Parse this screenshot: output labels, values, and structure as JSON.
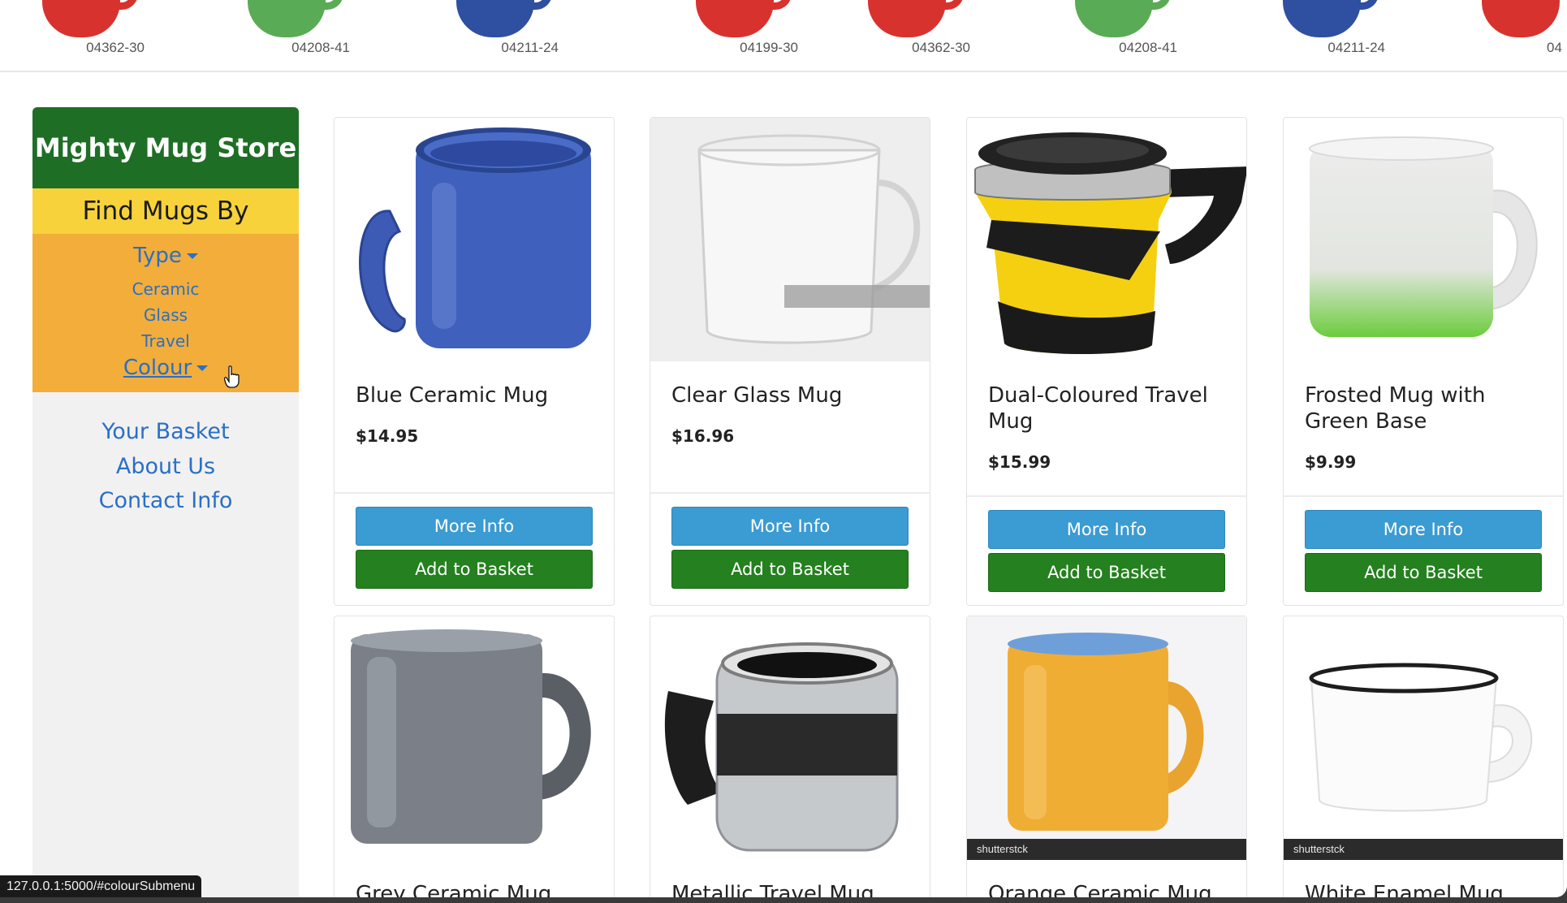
{
  "banner": {
    "items": [
      {
        "code": "04362-30",
        "color": "#d8322e"
      },
      {
        "code": "04208-41",
        "color": "#5aab55"
      },
      {
        "code": "04211-24",
        "color": "#2f4fa0"
      },
      {
        "code": "04199-30",
        "color": "#d8322e"
      },
      {
        "code": "04362-30",
        "color": "#d8322e"
      },
      {
        "code": "04208-41",
        "color": "#5aab55"
      },
      {
        "code": "04211-24",
        "color": "#2f4fa0"
      },
      {
        "code": "04",
        "color": "#d8322e"
      }
    ]
  },
  "sidebar": {
    "store_title": "Mighty Mug Store",
    "find_by": "Find Mugs By",
    "type_label": "Type",
    "type_items": [
      "Ceramic",
      "Glass",
      "Travel"
    ],
    "colour_label": "Colour",
    "links": [
      "Your Basket",
      "About Us",
      "Contact Info"
    ]
  },
  "products": [
    {
      "name": "Blue Ceramic Mug",
      "price": "$14.95",
      "more_info": "More Info",
      "add_basket": "Add to Basket",
      "image": "blue-ceramic-mug"
    },
    {
      "name": "Clear Glass Mug",
      "price": "$16.96",
      "more_info": "More Info",
      "add_basket": "Add to Basket",
      "image": "clear-glass-mug"
    },
    {
      "name": "Dual-Coloured Travel Mug",
      "price": "$15.99",
      "more_info": "More Info",
      "add_basket": "Add to Basket",
      "image": "dual-coloured-travel-mug"
    },
    {
      "name": "Frosted Mug with Green Base",
      "price": "$9.99",
      "more_info": "More Info",
      "add_basket": "Add to Basket",
      "image": "frosted-green-mug"
    },
    {
      "name": "Grey Ceramic Mug",
      "image": "grey-ceramic-mug"
    },
    {
      "name": "Metallic Travel Mug",
      "image": "metallic-travel-mug"
    },
    {
      "name": "Orange Ceramic Mug",
      "image": "orange-ceramic-mug",
      "watermark": "shutterstck"
    },
    {
      "name": "White Enamel Mug",
      "image": "white-enamel-mug",
      "watermark": "shutterstck"
    }
  ],
  "status_url": "127.0.0.1:5000/#colourSubmenu",
  "colors": {
    "title_green": "#1f6e25",
    "find_yellow": "#f7d23a",
    "filter_orange": "#f2ad3a",
    "link_blue": "#2a6fc7",
    "info_blue": "#3b9bd3",
    "basket_green": "#25801f"
  }
}
